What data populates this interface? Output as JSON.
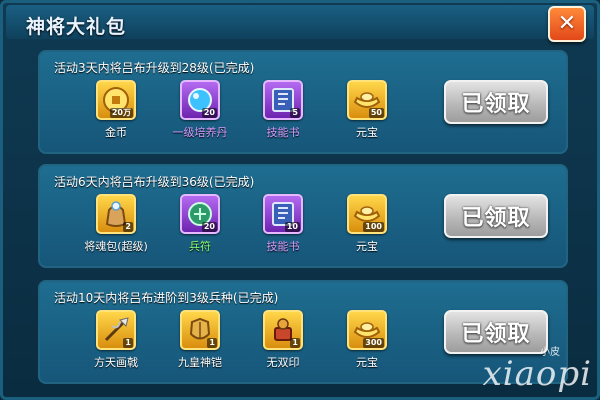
{
  "window": {
    "title": "神将大礼包",
    "close_icon": "close-icon"
  },
  "colors": {
    "accent": "#1e6d90",
    "gold": "#ffd64a",
    "purple_text": "#d89cff",
    "green_text": "#8dff6e"
  },
  "tasks": [
    {
      "text": "活动3天内将吕布升级到28级(已完成)",
      "button": "已领取",
      "rewards": [
        {
          "name": "金币",
          "qty": "20万",
          "icon": "gold-coin-icon",
          "rarity": "gold"
        },
        {
          "name": "一级培养丹",
          "qty": "20",
          "icon": "blue-pill-icon",
          "rarity": "purple"
        },
        {
          "name": "技能书",
          "qty": "5",
          "icon": "skill-book-icon",
          "rarity": "purple"
        },
        {
          "name": "元宝",
          "qty": "50",
          "icon": "gold-ingot-icon",
          "rarity": "gold"
        }
      ]
    },
    {
      "text": "活动6天内将吕布升级到36级(已完成)",
      "button": "已领取",
      "rewards": [
        {
          "name": "将魂包(超级)",
          "qty": "2",
          "icon": "soul-bag-icon",
          "rarity": "gold"
        },
        {
          "name": "兵符",
          "qty": "20",
          "icon": "tiger-tally-icon",
          "rarity": "purple"
        },
        {
          "name": "技能书",
          "qty": "10",
          "icon": "skill-book-icon",
          "rarity": "purple"
        },
        {
          "name": "元宝",
          "qty": "100",
          "icon": "gold-ingot-icon",
          "rarity": "gold"
        }
      ]
    },
    {
      "text": "活动10天内将吕布进阶到3级兵种(已完成)",
      "button": "已领取",
      "rewards": [
        {
          "name": "方天画戟",
          "qty": "1",
          "icon": "halberd-icon",
          "rarity": "gold"
        },
        {
          "name": "九皇神铠",
          "qty": "1",
          "icon": "armor-icon",
          "rarity": "gold"
        },
        {
          "name": "无双印",
          "qty": "1",
          "icon": "seal-icon",
          "rarity": "gold"
        },
        {
          "name": "元宝",
          "qty": "300",
          "icon": "gold-ingot-icon",
          "rarity": "gold"
        }
      ]
    }
  ],
  "watermark": {
    "small": "小皮",
    "large": "xiaopi"
  }
}
